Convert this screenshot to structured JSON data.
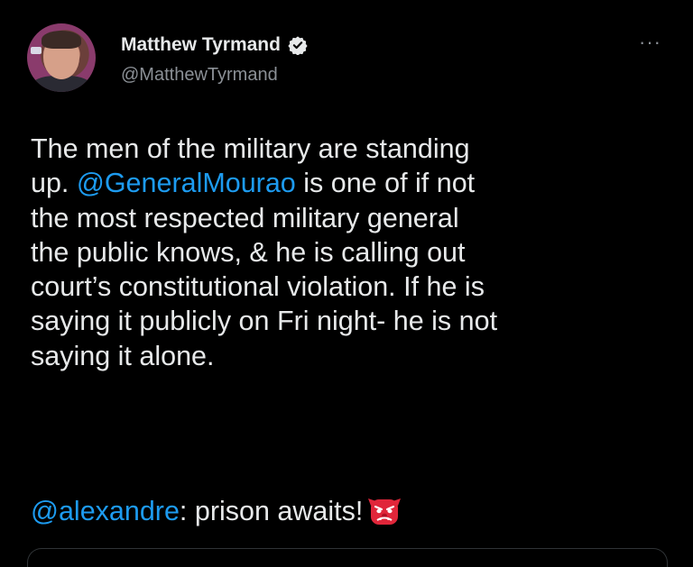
{
  "author": {
    "name": "Matthew Tyrmand",
    "handle": "@MatthewTyrmand",
    "verified_icon": "verified-badge-icon"
  },
  "menu": {
    "more_label": "···"
  },
  "tweet": {
    "lines": [
      [
        {
          "t": "The men of the military are standing",
          "m": false
        }
      ],
      [
        {
          "t": "up. ",
          "m": false
        },
        {
          "t": "@GeneralMourao",
          "m": true
        },
        {
          "t": " is one of if not",
          "m": false
        }
      ],
      [
        {
          "t": "the most respected military general",
          "m": false
        }
      ],
      [
        {
          "t": "the public knows, & he is calling out",
          "m": false
        }
      ],
      [
        {
          "t": "court’s constitutional violation. If he is",
          "m": false
        }
      ],
      [
        {
          "t": "saying it publicly on Fri night- he is not",
          "m": false
        }
      ],
      [
        {
          "t": "saying it alone.",
          "m": false
        }
      ]
    ],
    "reply_mention": "@alexandre",
    "reply_text": ": prison awaits!",
    "emoji": "goblin-face-icon"
  },
  "colors": {
    "mention": "#1d9bf0",
    "background": "#000000",
    "text": "#e7e9ea",
    "secondary": "#8b9096"
  }
}
